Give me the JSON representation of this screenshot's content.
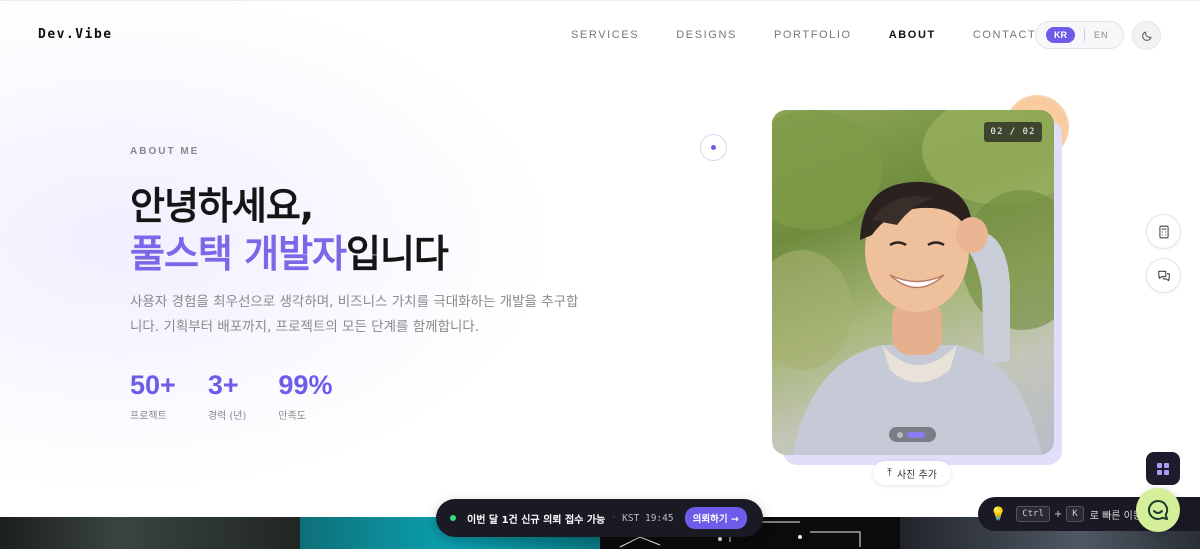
{
  "header": {
    "logo": "Dev.Vibe",
    "nav": [
      {
        "label": "SERVICES"
      },
      {
        "label": "DESIGNS"
      },
      {
        "label": "PORTFOLIO"
      },
      {
        "label": "ABOUT",
        "active": true
      },
      {
        "label": "CONTACT"
      }
    ],
    "lang": {
      "kr": "KR",
      "en": "EN"
    },
    "theme_icon": "moon-icon"
  },
  "hero": {
    "eyebrow": "ABOUT ME",
    "title_line1": "안녕하세요,",
    "title_line2_accent": "풀스택 개발자",
    "title_line2_rest": "입니다",
    "description": "사용자 경험을 최우선으로 생각하며, 비즈니스 가치를 극대화하는 개발을 추구합니다. 기획부터 배포까지, 프로젝트의 모든 단계를 함께합니다.",
    "stats": [
      {
        "value": "50+",
        "label": "프로젝트"
      },
      {
        "value": "3+",
        "label": "경력 (년)"
      },
      {
        "value": "99%",
        "label": "만족도"
      }
    ]
  },
  "photo": {
    "counter": "02 / 02",
    "add_label": "사진 추가"
  },
  "notice": {
    "text": "이번 달 1건 신규 의뢰 접수 가능",
    "separator": "·",
    "time": "KST 19:45",
    "cta": "의뢰하기 →"
  },
  "shortcut": {
    "key1": "Ctrl",
    "plus": "+",
    "key2": "K",
    "hint": "로 빠른 이동"
  },
  "colors": {
    "accent": "#6d5ce7",
    "dark": "#1a1a24",
    "online": "#3ddc84"
  }
}
